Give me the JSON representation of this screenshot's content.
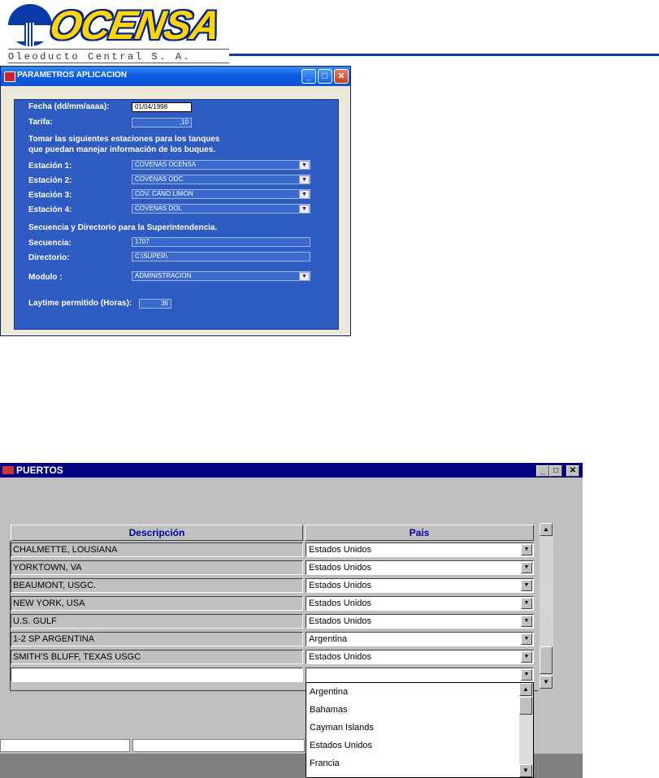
{
  "logo": {
    "brand": "OCENSA",
    "subtitle": "Oleoducto Central S. A."
  },
  "param_window": {
    "title": "PARAMETROS APLICACION",
    "fecha_label": "Fecha (dd/mm/aaaa):",
    "fecha_value": "01/04/1998",
    "tarifa_label": "Tarifa:",
    "tarifa_value": ",10",
    "instruction_line1": "Tomar las siguientes estaciones para los tanques",
    "instruction_line2": "que puedan manejar información de los buques.",
    "estacion1_label": "Estación 1:",
    "estacion1_value": "COVENAS OCENSA",
    "estacion2_label": "Estación 2:",
    "estacion2_value": "COVENAS ODC",
    "estacion3_label": "Estación 3:",
    "estacion3_value": "COV.  CANO LIMON",
    "estacion4_label": "Estación 4:",
    "estacion4_value": "COVENAS  DOL",
    "section_label": "Secuencia y Directorio para la Superintendencia.",
    "secuencia_label": "Secuencia:",
    "secuencia_value": "1707",
    "directorio_label": "Directorio:",
    "directorio_value": "C:\\SUPER\\",
    "modulo_label": "Modulo :",
    "modulo_value": "ADMINISTRACION",
    "laytime_label": "Laytime permitido (Horas):",
    "laytime_value": "36"
  },
  "ports_window": {
    "title": "PUERTOS",
    "col_descripcion": "Descripción",
    "col_pais": "Pais",
    "rows": [
      {
        "descripcion": "CHALMETTE, LOUSIANA",
        "pais": "Estados Unidos"
      },
      {
        "descripcion": "YORKTOWN, VA",
        "pais": "Estados Unidos"
      },
      {
        "descripcion": "BEAUMONT, USGC.",
        "pais": "Estados Unidos"
      },
      {
        "descripcion": "NEW YORK, USA",
        "pais": "Estados Unidos"
      },
      {
        "descripcion": "U.S. GULF",
        "pais": "Estados Unidos"
      },
      {
        "descripcion": "1-2  SP ARGENTINA",
        "pais": "Argentina"
      },
      {
        "descripcion": "SMITH'S BLUFF, TEXAS USGC",
        "pais": "Estados Unidos"
      }
    ],
    "dropdown_options": [
      "Argentina",
      "Bahamas",
      "Cayman Islands",
      "Estados Unidos",
      "Francia"
    ]
  },
  "colors": {
    "panel_blue": "#2e5bc2",
    "xp_title": "#0a5ae0",
    "w95_title": "#000080",
    "header_text": "#0000a0",
    "logo_yellow": "#ffd500"
  },
  "icons": [
    "chevron-down-icon",
    "minimize-icon",
    "maximize-icon",
    "close-icon",
    "scroll-up-icon",
    "scroll-down-icon",
    "app-icon"
  ]
}
